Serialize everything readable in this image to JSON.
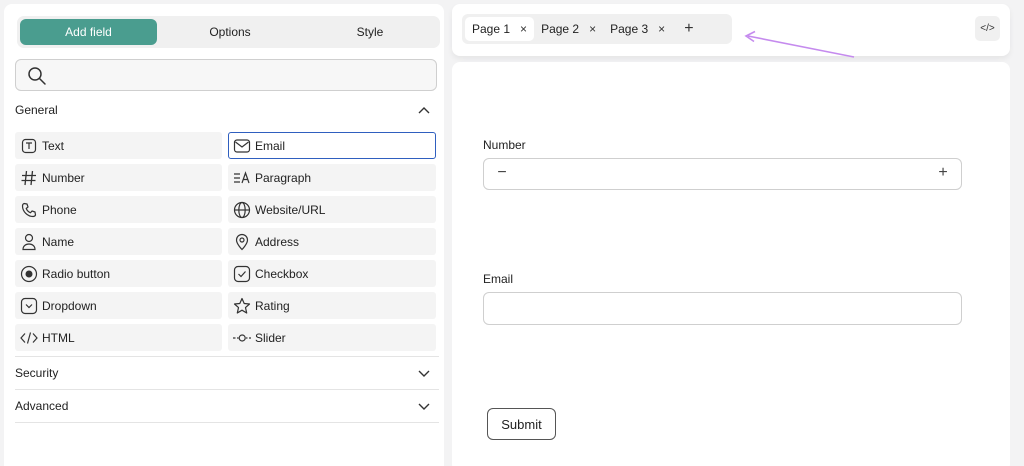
{
  "builder": {
    "tabs": [
      "Add field",
      "Options",
      "Style"
    ],
    "search": {
      "placeholder": "",
      "value": ""
    },
    "sections": {
      "general": "General",
      "security": "Security",
      "advanced": "Advanced"
    },
    "fields": [
      {
        "label": "Text",
        "icon": "text-icon"
      },
      {
        "label": "Email",
        "icon": "email-icon",
        "selected": true
      },
      {
        "label": "Number",
        "icon": "hash-icon"
      },
      {
        "label": "Paragraph",
        "icon": "paragraph-icon"
      },
      {
        "label": "Phone",
        "icon": "phone-icon"
      },
      {
        "label": "Website/URL",
        "icon": "globe-icon"
      },
      {
        "label": "Name",
        "icon": "person-icon"
      },
      {
        "label": "Address",
        "icon": "location-pin-icon"
      },
      {
        "label": "Radio button",
        "icon": "radio-icon"
      },
      {
        "label": "Checkbox",
        "icon": "checkbox-icon"
      },
      {
        "label": "Dropdown",
        "icon": "dropdown-icon"
      },
      {
        "label": "Rating",
        "icon": "star-icon"
      },
      {
        "label": "HTML",
        "icon": "code-icon"
      },
      {
        "label": "Slider",
        "icon": "slider-icon"
      }
    ]
  },
  "pages": {
    "tabs": [
      "Page 1",
      "Page 2",
      "Page 3"
    ],
    "active_tab": "Page 1",
    "close_glyph": "×",
    "add_glyph": "+",
    "code_glyph": "</>"
  },
  "form": {
    "number_label": "Number",
    "number_minus": "−",
    "number_plus": "+",
    "email_label": "Email",
    "email_value": "",
    "submit_label": "Submit"
  },
  "colors": {
    "accent": "#4a9d8f",
    "selected_border": "#2f5fbf",
    "annotation_arrow": "#c58bee"
  }
}
